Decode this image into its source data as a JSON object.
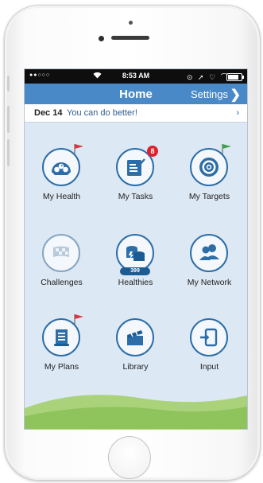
{
  "status_bar": {
    "signal": "●●○○○",
    "time": "8:53 AM",
    "right_icons": "⊙ ➚ ♡ ⌒",
    "battery_level": 0.9
  },
  "nav_bar": {
    "title": "Home",
    "settings_label": "Settings",
    "settings_chevron": "❯"
  },
  "notice": {
    "date": "Dec 14",
    "message": "You can do better!",
    "arrow": "›"
  },
  "tiles": [
    {
      "label": "My Health",
      "icon": "speedometer-icon"
    },
    {
      "label": "My Tasks",
      "icon": "task-list-icon",
      "badge": "8"
    },
    {
      "label": "My Targets",
      "icon": "target-icon"
    },
    {
      "label": "Challenges",
      "icon": "checkered-flag-icon"
    },
    {
      "label": "Healthies",
      "icon": "coins-icon",
      "count": "399"
    },
    {
      "label": "My Network",
      "icon": "people-icon"
    },
    {
      "label": "My Plans",
      "icon": "scroll-icon"
    },
    {
      "label": "Library",
      "icon": "clapperboard-icon"
    },
    {
      "label": "Input",
      "icon": "enter-icon"
    }
  ],
  "colors": {
    "nav_blue": "#4a89c8",
    "icon_blue": "#2d6ea8",
    "flag_red": "#d9363e",
    "flag_green": "#3ea34a",
    "badge_red": "#e0202c",
    "grass_green": "#8fc35c"
  }
}
